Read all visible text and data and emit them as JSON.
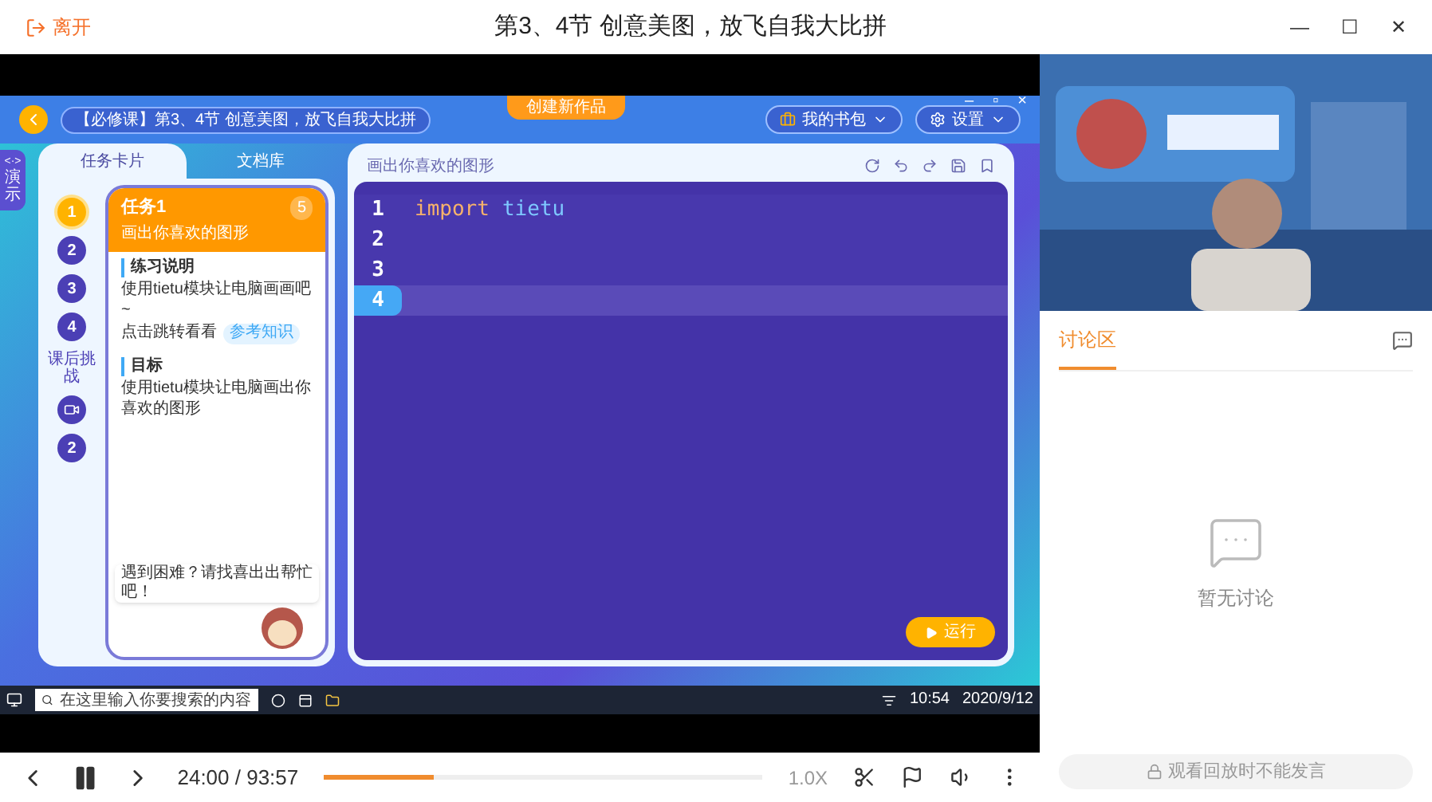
{
  "header": {
    "leave": "离开",
    "title": "第3、4节 创意美图，放飞自我大比拼",
    "controls": [
      "—",
      "☐",
      "✕"
    ]
  },
  "app": {
    "window_controls": [
      "–",
      "▫",
      "×"
    ],
    "course_title": "【必修课】第3、4节 创意美图，放飞自我大比拼",
    "center_tab": "创建新作品",
    "menus": [
      {
        "label": "我的书包",
        "kind": "bag"
      },
      {
        "label": "设置",
        "kind": "gear"
      }
    ],
    "side_tab": {
      "icon": "<·>",
      "label": "演示"
    },
    "tabs": [
      {
        "label": "任务卡片",
        "selected": true
      },
      {
        "label": "文档库",
        "selected": false
      }
    ],
    "steps": [
      {
        "label": "1",
        "selected": true,
        "kind": "number"
      },
      {
        "label": "2",
        "selected": false,
        "kind": "number"
      },
      {
        "label": "3",
        "selected": false,
        "kind": "number"
      },
      {
        "label": "4",
        "selected": false,
        "kind": "number"
      }
    ],
    "challenge": {
      "title": "课后挑战",
      "steps": [
        {
          "selected": false,
          "kind": "video"
        },
        {
          "label": "2",
          "selected": false,
          "kind": "number"
        }
      ]
    },
    "task": {
      "title": "任务1",
      "subtitle": "画出你喜欢的图形",
      "badge": "5",
      "sections": [
        {
          "heading": "练习说明",
          "text": "使用tietu模块让电脑画画吧~",
          "link_label": "点击跳转看看",
          "link": "参考知识"
        },
        {
          "heading": "目标",
          "text": "使用tietu模块让电脑画出你喜欢的图形"
        }
      ],
      "bubble": "遇到困难？请找喜出出帮忙吧！"
    },
    "editor": {
      "title": "画出你喜欢的图形",
      "lines": [
        {
          "number": "1",
          "keyword": "import",
          "text": "tietu",
          "selected": false
        },
        {
          "number": "2",
          "selected": false
        },
        {
          "number": "3",
          "selected": false
        },
        {
          "number": "4",
          "selected": true
        }
      ],
      "run": "运行"
    },
    "taskbar": {
      "search_placeholder": "在这里输入你要搜索的内容",
      "time": "10:54",
      "date": "2020/9/12"
    }
  },
  "player": {
    "time": "24:00 / 93:57",
    "level": 0.25,
    "speed": "1.0X"
  },
  "discussion": {
    "tabs": [
      {
        "label": "讨论区",
        "selected": true
      }
    ],
    "empty": "暂无讨论",
    "footer": "观看回放时不能发言"
  }
}
